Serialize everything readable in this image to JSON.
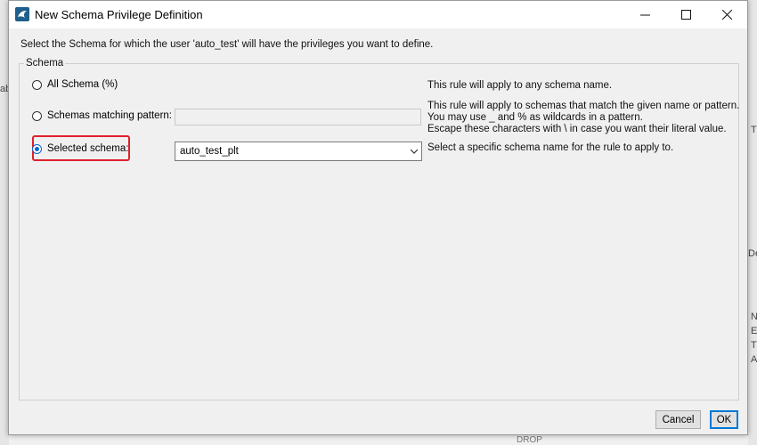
{
  "background": {
    "left_fragment": "ab",
    "right_fragments": [
      "T",
      "De",
      "N",
      "E",
      "TE",
      "A"
    ],
    "bottom_fragment": "DROP"
  },
  "window": {
    "title": "New Schema Privilege Definition",
    "controls": {
      "minimize": "—",
      "maximize": "☐",
      "close": "✕"
    }
  },
  "instruction": "Select the Schema for which the user 'auto_test' will have the privileges you want to define.",
  "group": {
    "label": "Schema",
    "options": [
      {
        "label": "All Schema (%)",
        "checked": false,
        "description": [
          "This rule will apply to any schema name."
        ]
      },
      {
        "label": "Schemas matching pattern:",
        "checked": false,
        "input_value": "",
        "description": [
          "This rule will apply to schemas that match the given name or pattern.",
          "You may use _ and % as wildcards in a pattern.",
          "Escape these characters with \\ in case you want their literal value."
        ]
      },
      {
        "label": "Selected schema:",
        "checked": true,
        "selected_value": "auto_test_plt",
        "description": [
          "Select a specific schema name for the rule to apply to."
        ]
      }
    ]
  },
  "buttons": {
    "cancel": "Cancel",
    "ok": "OK"
  },
  "colors": {
    "accent": "#0a64d0",
    "highlight": "#e0202a"
  }
}
